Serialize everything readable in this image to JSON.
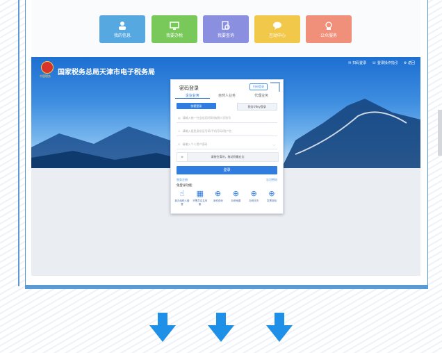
{
  "tiles": [
    {
      "label": "我的信息",
      "color": "#56a8e0",
      "icon": "person-icon"
    },
    {
      "label": "我要办税",
      "color": "#78c85a",
      "icon": "monitor-icon"
    },
    {
      "label": "我要查询",
      "color": "#8a8fe0",
      "icon": "search-doc-icon"
    },
    {
      "label": "互动中心",
      "color": "#f2c84a",
      "icon": "chat-icon"
    },
    {
      "label": "公众服务",
      "color": "#f08f7a",
      "icon": "service-icon"
    }
  ],
  "portal": {
    "site_title": "国家税务总局天津市电子税务局",
    "emblem_caption": "中国税务",
    "header_links": [
      "✉ 扫码登录",
      "☏ 登录操作指引",
      "⚙ 返回"
    ]
  },
  "login": {
    "title": "密码登录",
    "switch_label": "扫码登录",
    "tabs": [
      "企业业务",
      "自然人业务",
      "代理业务"
    ],
    "subtabs": [
      "快捷登录",
      "税务UKey登录"
    ],
    "fields": [
      "请输入统一社会信用代码/纳税人识别号",
      "请输入居民身份证号码/手机号码/用户名",
      "请输入个人用户密码"
    ],
    "slider_text": "请按住滑块，拖动到最右边",
    "submit_label": "登录",
    "register_link": "税务注册",
    "forgot_link": "忘记密码",
    "nologin_title": "免登录功能",
    "quick_items": [
      {
        "label": "新办纳税人套餐",
        "icon": "hand-click-icon"
      },
      {
        "label": "开票员实名采集",
        "icon": "doc-check-icon"
      },
      {
        "label": "涉税查询",
        "icon": "magnify-icon"
      },
      {
        "label": "办税地图",
        "icon": "magnify-icon"
      },
      {
        "label": "办税日历",
        "icon": "magnify-icon"
      },
      {
        "label": "发票查验",
        "icon": "magnify-icon"
      }
    ]
  },
  "colors": {
    "accent": "#2f7de0",
    "arrow": "#1e90e8",
    "frame": "#5b9bd5"
  }
}
